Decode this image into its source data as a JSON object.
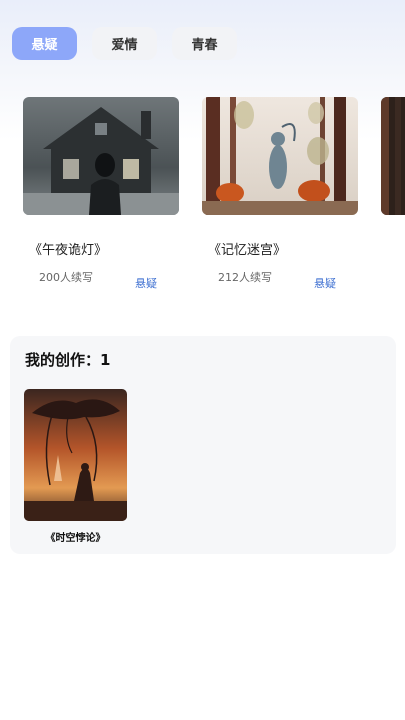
{
  "tabs": [
    {
      "label": "悬疑",
      "active": true
    },
    {
      "label": "爱情",
      "active": false
    },
    {
      "label": "青春",
      "active": false
    }
  ],
  "stories": [
    {
      "title": "《午夜诡灯》",
      "count": "200人续写",
      "genre": "悬疑",
      "cover_icon": "haunted-house-cover"
    },
    {
      "title": "《记忆迷宫》",
      "count": "212人续写",
      "genre": "悬疑",
      "cover_icon": "forest-ghost-cover"
    },
    {
      "title": "",
      "count": "",
      "genre": "",
      "cover_icon": "partial-cover"
    }
  ],
  "my_works": {
    "title": "我的创作：1",
    "items": [
      {
        "title": "《时空悖论》",
        "cover_icon": "sunset-tree-cover"
      }
    ]
  },
  "colors": {
    "accent": "#8da7f9",
    "genre": "#3d6fd1"
  }
}
